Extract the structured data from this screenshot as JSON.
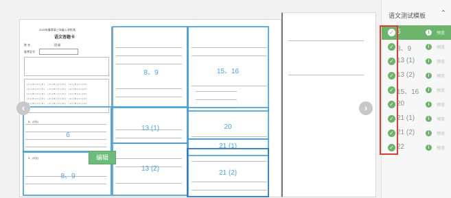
{
  "sheet": {
    "title": "2020年春季高三年级入学检测",
    "subtitle": "语文答题卡",
    "name_label": "姓 名",
    "class_label": "班 级",
    "exam_no_label": "准考证号",
    "q_header_a": "8、(8分)",
    "q_header_b": "9、(6分)"
  },
  "zones": [
    {
      "label": "8、9"
    },
    {
      "label": "15、16"
    },
    {
      "label": "6"
    },
    {
      "label": "13 (1)"
    },
    {
      "label": "20"
    },
    {
      "label": "21 (1)"
    },
    {
      "label": "8、9"
    },
    {
      "label": "13 (2)"
    },
    {
      "label": "21 (2)"
    }
  ],
  "edit_button": "编辑",
  "nav": {
    "prev": "‹",
    "next": "›"
  },
  "panel": {
    "title": "语文测试模板",
    "toggle_icon": "chevron-up-icon",
    "items": [
      {
        "label": "6",
        "preview": "预览",
        "selected": true
      },
      {
        "label": "8、9",
        "preview": "预览",
        "selected": false
      },
      {
        "label": "13 (1)",
        "preview": "预览",
        "selected": false
      },
      {
        "label": "13 (2)",
        "preview": "预览",
        "selected": false
      },
      {
        "label": "15、16",
        "preview": "预览",
        "selected": false
      },
      {
        "label": "20",
        "preview": "预览",
        "selected": false
      },
      {
        "label": "21 (1)",
        "preview": "预览",
        "selected": false
      },
      {
        "label": "21 (2)",
        "preview": "预览",
        "selected": false
      },
      {
        "label": "22",
        "preview": "预览",
        "selected": false
      }
    ]
  },
  "colors": {
    "accent": "#6ab56a",
    "zone": "#42a0e6",
    "highlight": "#e03a2e"
  }
}
